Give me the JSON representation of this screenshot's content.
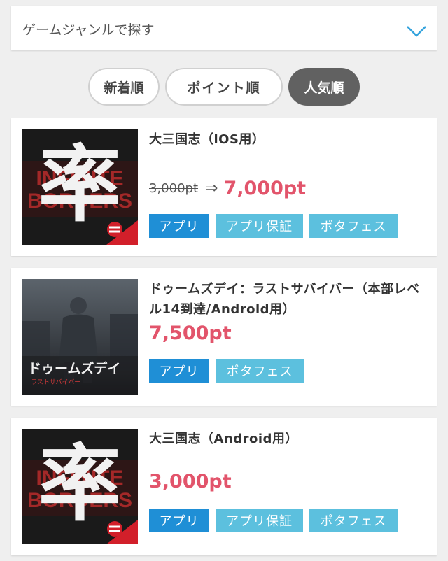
{
  "genre_filter": {
    "label": "ゲームジャンルで探す",
    "icon": "chevron-down-icon"
  },
  "sort_tabs": [
    {
      "label": "新着順",
      "active": false
    },
    {
      "label": "ポイント順",
      "active": false
    },
    {
      "label": "人気順",
      "active": true
    }
  ],
  "colors": {
    "accent_price": "#e2546b",
    "tag_app": "#1f8fd6",
    "tag_other": "#5cc0de",
    "active_tab": "#616161"
  },
  "items": [
    {
      "title": "大三国志（iOS用）",
      "old_price": "3,000pt",
      "arrow": "⇒",
      "price": "7,000pt",
      "tags": [
        "アプリ",
        "アプリ保証",
        "ポタフェス"
      ],
      "thumb": {
        "big_char": "率",
        "bg_text_1": "INFINITE",
        "bg_text_2": "BORDERS"
      }
    },
    {
      "title": "ドゥームズデイ：ラストサバイバー（本部レベル14到達/Android用）",
      "price": "7,500pt",
      "tags": [
        "アプリ",
        "ポタフェス"
      ],
      "thumb": {
        "logo_text": "ドゥームズデイ",
        "sub_text": "ラストサバイバー"
      }
    },
    {
      "title": "大三国志（Android用）",
      "price": "3,000pt",
      "tags": [
        "アプリ",
        "アプリ保証",
        "ポタフェス"
      ],
      "thumb": {
        "big_char": "率",
        "bg_text_1": "INFINITE",
        "bg_text_2": "BORDERS"
      }
    }
  ]
}
